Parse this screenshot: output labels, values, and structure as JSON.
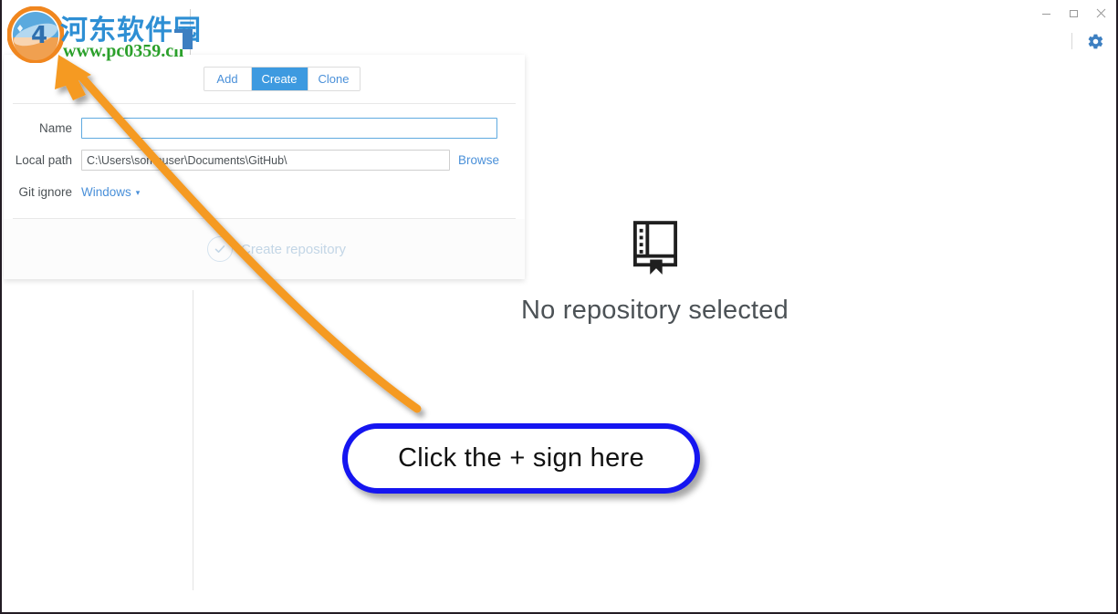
{
  "window": {
    "controls": [
      {
        "name": "minimize",
        "glyph": "minimize-icon"
      },
      {
        "name": "maximize",
        "glyph": "maximize-icon"
      },
      {
        "name": "close",
        "glyph": "close-icon"
      }
    ]
  },
  "toolbar": {
    "settings_icon": "gear-icon"
  },
  "watermark": {
    "title": "河东软件园",
    "url": "www.pc0359.cn",
    "logo_icon": "site-logo-icon"
  },
  "create_panel": {
    "tabs": [
      {
        "label": "Add",
        "active": false
      },
      {
        "label": "Create",
        "active": true
      },
      {
        "label": "Clone",
        "active": false
      }
    ],
    "fields": {
      "name_label": "Name",
      "name_value": "",
      "name_placeholder": "",
      "local_path_label": "Local path",
      "local_path_value": "C:\\Users\\someuser\\Documents\\GitHub\\",
      "browse_label": "Browse",
      "git_ignore_label": "Git ignore",
      "git_ignore_value": "Windows",
      "git_ignore_caret": "▾"
    },
    "footer": {
      "submit_label": "Create repository",
      "submit_icon": "check-circle-icon",
      "submit_enabled": false
    }
  },
  "empty_state": {
    "icon": "repo-book-icon",
    "title": "No repository selected"
  },
  "annotations": {
    "callout_text": "Click the + sign here",
    "callout_border_color": "#1515f0",
    "arrow_color": "#f59a23",
    "arrow_icon": "pointer-arrow-icon"
  }
}
